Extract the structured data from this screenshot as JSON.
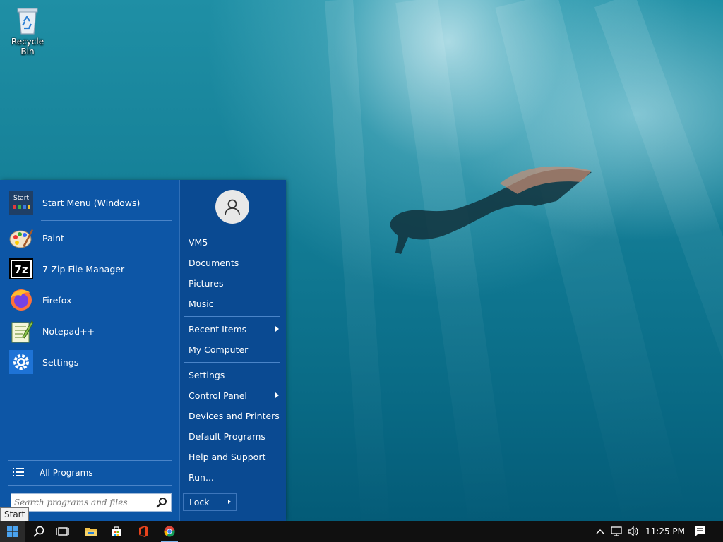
{
  "desktop": {
    "icons": [
      {
        "label": "Recycle Bin",
        "icon": "recycle-bin-icon"
      }
    ]
  },
  "start_menu": {
    "pinned": [
      {
        "label": "Start Menu (Windows)",
        "icon": "start-menu-app-icon",
        "icon_text": "Start"
      },
      {
        "label": "Paint",
        "icon": "paint-icon"
      },
      {
        "label": "7-Zip File Manager",
        "icon": "seven-zip-icon",
        "icon_text": "7z"
      },
      {
        "label": "Firefox",
        "icon": "firefox-icon"
      },
      {
        "label": "Notepad++",
        "icon": "notepad-plus-plus-icon"
      },
      {
        "label": "Settings",
        "icon": "gear-icon"
      }
    ],
    "all_programs_label": "All Programs",
    "search_placeholder": "Search programs and files",
    "right_items": {
      "user": "VM5",
      "documents": "Documents",
      "pictures": "Pictures",
      "music": "Music",
      "recent_items": "Recent Items",
      "my_computer": "My Computer",
      "settings": "Settings",
      "control_panel": "Control Panel",
      "devices_printers": "Devices and Printers",
      "default_programs": "Default Programs",
      "help_support": "Help and Support",
      "run": "Run..."
    },
    "lock_label": "Lock"
  },
  "tooltip": {
    "text": "Start"
  },
  "taskbar": {
    "pinned": [
      "windows-logo-icon",
      "search-icon",
      "task-view-icon",
      "file-explorer-icon",
      "store-icon",
      "office-icon",
      "chrome-icon"
    ],
    "tray_icons": [
      "chevron-up-icon",
      "network-icon",
      "volume-icon",
      "action-center-icon"
    ],
    "clock": "11:25 PM"
  },
  "colors": {
    "menu_left": "#0d56a6",
    "menu_right": "#0a4a92",
    "taskbar": "#101010"
  }
}
